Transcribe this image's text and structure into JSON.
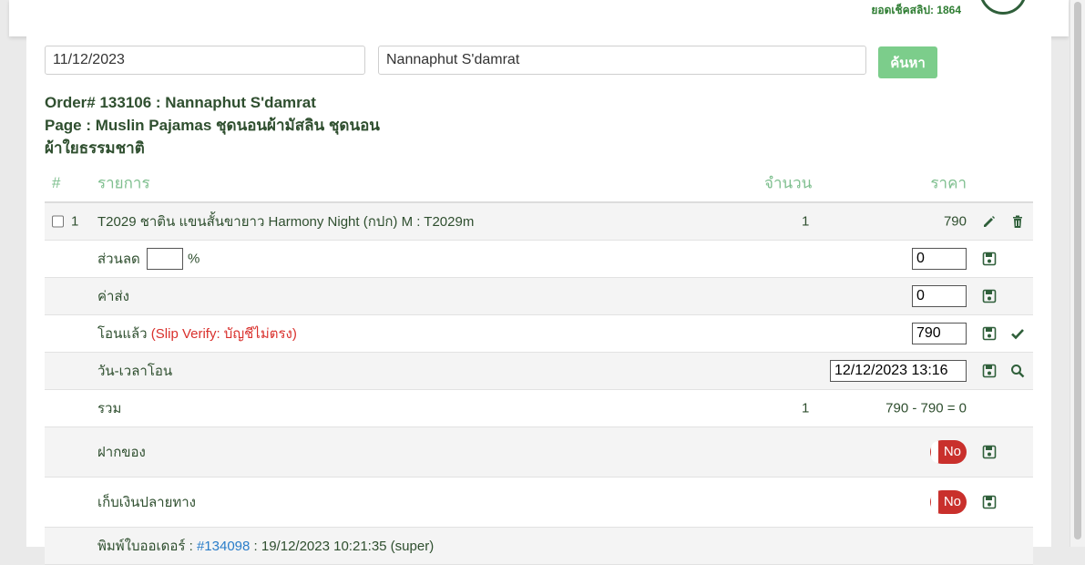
{
  "header": {
    "slip_count": "ยอดเช็คสลิป: 1864"
  },
  "search": {
    "date_value": "11/12/2023",
    "name_value": "Nannaphut S'damrat",
    "button_label": "ค้นหา"
  },
  "order": {
    "title": "Order# 133106 : Nannaphut S'damrat",
    "page_line1": "Page : Muslin Pajamas ชุดนอนผ้ามัสลิน ชุดนอน",
    "page_line2": "ผ้าใยธรรมชาติ"
  },
  "table": {
    "headers": {
      "num": "#",
      "item": "รายการ",
      "qty": "จำนวน",
      "price": "ราคา"
    },
    "item": {
      "index": "1",
      "name": "T2029 ชาติน แขนสั้นขายาว Harmony Night (กปก) M : T2029m",
      "qty": "1",
      "price": "790"
    },
    "discount": {
      "label": "ส่วนลด",
      "percent_value": "",
      "percent_sign": "%",
      "value": "0"
    },
    "shipping": {
      "label": "ค่าส่ง",
      "value": "0"
    },
    "transferred": {
      "label": "โอนแล้ว",
      "verify_note": "(Slip Verify: บัญชีไม่ตรง)",
      "value": "790"
    },
    "transfer_datetime": {
      "label": "วัน-เวลาโอน",
      "value": "12/12/2023 13:16"
    },
    "total": {
      "label": "รวม",
      "qty": "1",
      "value": "790 - 790 = 0"
    },
    "deposit": {
      "label": "ฝากของ",
      "toggle": "No"
    },
    "cod": {
      "label": "เก็บเงินปลายทาง",
      "toggle": "No"
    },
    "print": {
      "label": "พิมพ์ใบออเดอร์ : ",
      "link": "#134098",
      "suffix": " : 19/12/2023 10:21:35 (super)"
    }
  },
  "icons": [
    "pencil-icon",
    "trash-icon",
    "save-icon",
    "check-icon",
    "search-icon"
  ],
  "colors": {
    "accent": "#7ccd8b",
    "heading": "#2f4f2f",
    "alert": "#d9302c",
    "toggle_off": "#c9302c",
    "link": "#2a7dc9"
  }
}
